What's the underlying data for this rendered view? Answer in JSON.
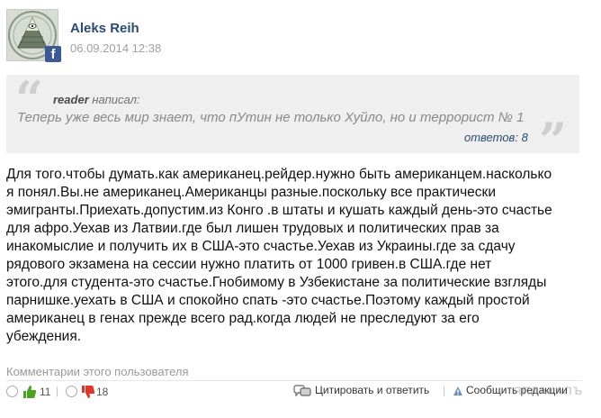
{
  "post": {
    "author": "Aleks Reih",
    "date": "06.09.2014 12:38",
    "social_badge": "f"
  },
  "quote": {
    "user": "reader",
    "wrote": "написал:",
    "text": "Теперь уже весь мир знает, что пУтин не только Хуйло, но и террорист № 1",
    "replies": "ответов: 8"
  },
  "body": {
    "lines": [
      "Для того.чтобы думать.как американец.рейдер.нужно быть американцем.насколько",
      "я понял.Вы.не американец.Американцы разные.поскольку все практически",
      "эмигранты.Приехать.допустим.из Конго .в штаты и кушать каждый день-это счастье",
      "для афро.Уехав из Латвии.где был лишен трудовых и политических прав за",
      "инакомыслие и получить их в США-это счастье.Уехав из Украины.где за сдачу",
      "рядового экзамена на сессии нужно платить от 1000 гривен.в США.где нет",
      "этого.для студента-это счастье.Гнобимому в Узбекистане за политические взгляды",
      "парнишке.уехать в США и спокойно спать -это счастье.Поэтому каждый простой",
      "американец в генах прежде всего рад.когда людей не преследуют за его",
      "убеждения."
    ]
  },
  "footer": {
    "user_comments_link": "Комментарии этого пользователя",
    "likes": "11",
    "dislikes": "18",
    "reply_label": "Цитировать и ответить",
    "report_label": "Сообщить редакции",
    "watermark": "ЯПЛАКАЛЪ"
  },
  "colors": {
    "author": "#2b4a75",
    "like": "#4ca320",
    "dislike": "#e0352b",
    "quote_bg": "#efefef"
  }
}
